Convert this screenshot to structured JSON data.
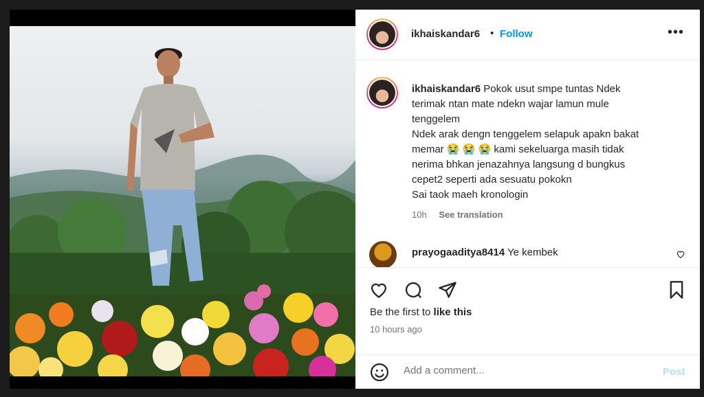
{
  "post": {
    "username": "ikhaiskandar6",
    "separator": "•",
    "follow_label": "Follow",
    "more_icon": "more-dots-icon"
  },
  "caption": {
    "username": "ikhaiskandar6",
    "lines": [
      "Pokok usut smpe tuntas Ndek",
      "terimak ntan mate ndekn wajar lamun mule",
      "tenggelem",
      "Ndek arak dengn tenggelem selapuk apakn bakat",
      "memar 😭 😭 😭 kami sekeluarga masih tidak",
      "nerima bhkan jenazahnya langsung d bungkus",
      "cepet2 seperti ada sesuatu pokokn",
      "Sai taok maeh kronologin"
    ],
    "age": "10h",
    "see_translation": "See translation"
  },
  "comments": [
    {
      "username": "prayogaaditya8414",
      "text": "Ye kembek"
    }
  ],
  "actions": {
    "icons": [
      "heart-icon",
      "comment-icon",
      "share-icon",
      "bookmark-icon"
    ]
  },
  "likes_text_prefix": "Be the first to ",
  "likes_text_bold": "like this",
  "timestamp": "10 hours ago",
  "add_comment": {
    "placeholder": "Add a comment...",
    "post_label": "Post"
  },
  "colors": {
    "follow": "#0095f6",
    "post_disabled": "#b3dbff",
    "text": "#262626",
    "muted": "#737373"
  }
}
